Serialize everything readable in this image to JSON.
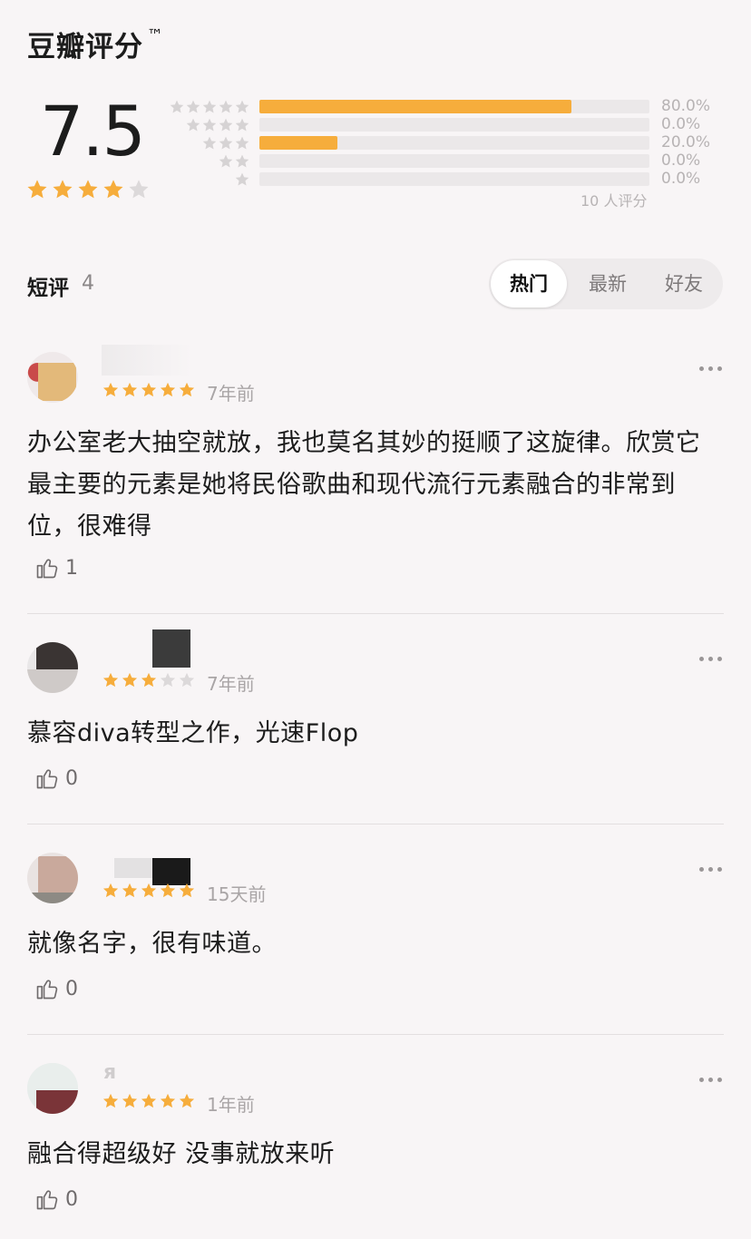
{
  "header": {
    "title": "豆瓣评分",
    "tm": "™"
  },
  "rating": {
    "score": "7.5",
    "stars_filled": 4,
    "distribution": [
      {
        "stars": 5,
        "percent": 80.0,
        "label": "80.0%"
      },
      {
        "stars": 4,
        "percent": 0.0,
        "label": "0.0%"
      },
      {
        "stars": 3,
        "percent": 20.0,
        "label": "20.0%"
      },
      {
        "stars": 2,
        "percent": 0.0,
        "label": "0.0%"
      },
      {
        "stars": 1,
        "percent": 0.0,
        "label": "0.0%"
      }
    ],
    "count_label": "10 人评分"
  },
  "short_reviews": {
    "label": "短评",
    "count": "4",
    "tabs": [
      {
        "label": "热门",
        "active": true
      },
      {
        "label": "最新",
        "active": false
      },
      {
        "label": "好友",
        "active": false
      }
    ]
  },
  "reviews": [
    {
      "stars": 5,
      "time": "7年前",
      "text": "办公室老大抽空就放，我也莫名其妙的挺顺了这旋律。欣赏它最主要的元素是她将民俗歌曲和现代流行元素融合的非常到位，很难得",
      "likes": "1"
    },
    {
      "stars": 3,
      "time": "7年前",
      "text": "慕容diva转型之作，光速Flop",
      "likes": "0"
    },
    {
      "stars": 5,
      "time": "15天前",
      "text": "就像名字，很有味道。",
      "likes": "0"
    },
    {
      "stars": 5,
      "time": "1年前",
      "name_fragment": "я",
      "text": "融合得超级好 没事就放来听",
      "likes": "0"
    }
  ],
  "colors": {
    "star": "#f6ad3c",
    "star_empty": "#dcd9da",
    "bar_fill": "#f6ad3c",
    "bar_track": "#ebe8e9",
    "background": "#f8f5f6"
  }
}
